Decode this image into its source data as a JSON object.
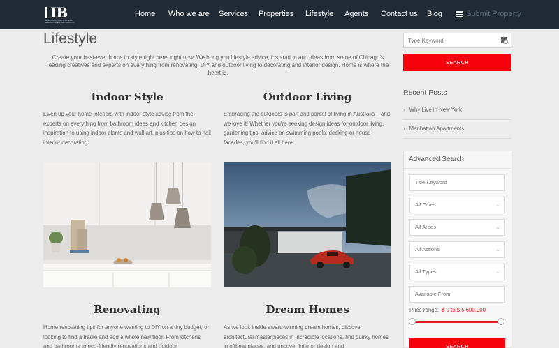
{
  "brand": {
    "logo_text": "IB",
    "logo_tagline": "INTERNATIONAL BUSINESS REAL ESTATE CORPORATION"
  },
  "nav": {
    "items": [
      "Home",
      "Who we are",
      "Services",
      "Properties",
      "Lifestyle",
      "Agents",
      "Contact us",
      "Blog"
    ],
    "submit_label": "Submit Property"
  },
  "page": {
    "title": "Lifestyle",
    "intro": "Create your best-ever home in style right here, right now. We bring you lifestyle advice, inspiration and ideas from some of Chicago's leading creatives and experts on everything from renovating, DIY and outdoor living to decorating and interior design. Home is where the heart is."
  },
  "cards": [
    {
      "title": "Indoor Style",
      "text": "Liven up your home interiors with indoor style advice from the experts on everything from bathroom ideas and kitchen design inspiration to using indoor plants and wall art, plus tips on how to nail interior decorating."
    },
    {
      "title": "Outdoor Living",
      "text": "Embracing the outdoors is part and parcel of living in Australia – and we love it! Whether you're seeking design ideas for outdoor living, gardening tips, advice on swimming pools, decking or house facades, you'll find it all here."
    },
    {
      "title": "Renovating",
      "text": "Home renovating tips for anyone wanting to DIY on a tiny budget, or looking to find a tradie and add a whole new floor. From kitchens and bathrooms to eco-friendly renovations and outdoor"
    },
    {
      "title": "Dream Homes",
      "text": "As we look inside award-winning dream homes, discover architectural masterpieces in incredible locations, find quirky homes in offbeat places, and uncover interior design and"
    }
  ],
  "sidebar": {
    "keyword_placeholder": "Type Keyword",
    "search_label": "SEARCH",
    "recent_title": "Recent Posts",
    "recent_posts": [
      "Why Live in New York",
      "Manhattan Apartments"
    ],
    "advanced_title": "Advanced Search",
    "title_keyword_placeholder": "Title Keyword",
    "selects": [
      "All Cities",
      "All Areas",
      "All Actions",
      "All Types"
    ],
    "available_from_placeholder": "Available From",
    "price_label": "Price range:",
    "price_value": "$ 0 to $ 5.600.000",
    "price_range": [
      0,
      5600000
    ],
    "search_label_2": "SEARCH"
  },
  "colors": {
    "nav_bg": "#1f2a35",
    "accent": "#f5000c",
    "page_bg": "#ececec"
  },
  "icons": {
    "menu": "hamburger-icon",
    "keyword": "grid-search-icon",
    "recent": "chevron-right-icon",
    "select": "chevron-down-icon"
  }
}
